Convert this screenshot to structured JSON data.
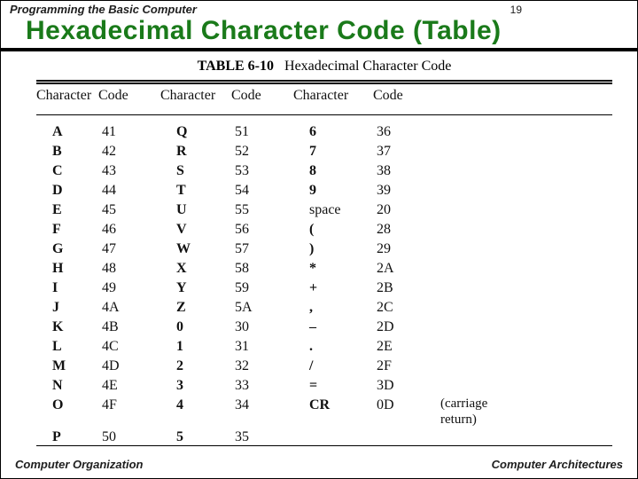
{
  "header": {
    "chapter": "Programming the Basic Computer",
    "page_number": "19",
    "title": "Hexadecimal Character Code (Table)"
  },
  "table": {
    "caption_label": "TABLE 6-10",
    "caption_text": "Hexadecimal Character Code",
    "columns": [
      "Character",
      "Code",
      "Character",
      "Code",
      "Character",
      "Code"
    ],
    "note": "(carriage return)",
    "rows": [
      {
        "c1": "A",
        "v1": "41",
        "c2": "Q",
        "v2": "51",
        "c3": "6",
        "v3": "36"
      },
      {
        "c1": "B",
        "v1": "42",
        "c2": "R",
        "v2": "52",
        "c3": "7",
        "v3": "37"
      },
      {
        "c1": "C",
        "v1": "43",
        "c2": "S",
        "v2": "53",
        "c3": "8",
        "v3": "38"
      },
      {
        "c1": "D",
        "v1": "44",
        "c2": "T",
        "v2": "54",
        "c3": "9",
        "v3": "39"
      },
      {
        "c1": "E",
        "v1": "45",
        "c2": "U",
        "v2": "55",
        "c3": "space",
        "v3": "20"
      },
      {
        "c1": "F",
        "v1": "46",
        "c2": "V",
        "v2": "56",
        "c3": "(",
        "v3": "28"
      },
      {
        "c1": "G",
        "v1": "47",
        "c2": "W",
        "v2": "57",
        "c3": ")",
        "v3": "29"
      },
      {
        "c1": "H",
        "v1": "48",
        "c2": "X",
        "v2": "58",
        "c3": "*",
        "v3": "2A"
      },
      {
        "c1": "I",
        "v1": "49",
        "c2": "Y",
        "v2": "59",
        "c3": "+",
        "v3": "2B"
      },
      {
        "c1": "J",
        "v1": "4A",
        "c2": "Z",
        "v2": "5A",
        "c3": ",",
        "v3": "2C"
      },
      {
        "c1": "K",
        "v1": "4B",
        "c2": "0",
        "v2": "30",
        "c3": "–",
        "v3": "2D"
      },
      {
        "c1": "L",
        "v1": "4C",
        "c2": "1",
        "v2": "31",
        "c3": ".",
        "v3": "2E"
      },
      {
        "c1": "M",
        "v1": "4D",
        "c2": "2",
        "v2": "32",
        "c3": "/",
        "v3": "2F"
      },
      {
        "c1": "N",
        "v1": "4E",
        "c2": "3",
        "v2": "33",
        "c3": "=",
        "v3": "3D"
      },
      {
        "c1": "O",
        "v1": "4F",
        "c2": "4",
        "v2": "34",
        "c3": "CR",
        "v3": "0D"
      },
      {
        "c1": "P",
        "v1": "50",
        "c2": "5",
        "v2": "35",
        "c3": "",
        "v3": ""
      }
    ]
  },
  "footer": {
    "left": "Computer Organization",
    "right": "Computer Architectures"
  }
}
